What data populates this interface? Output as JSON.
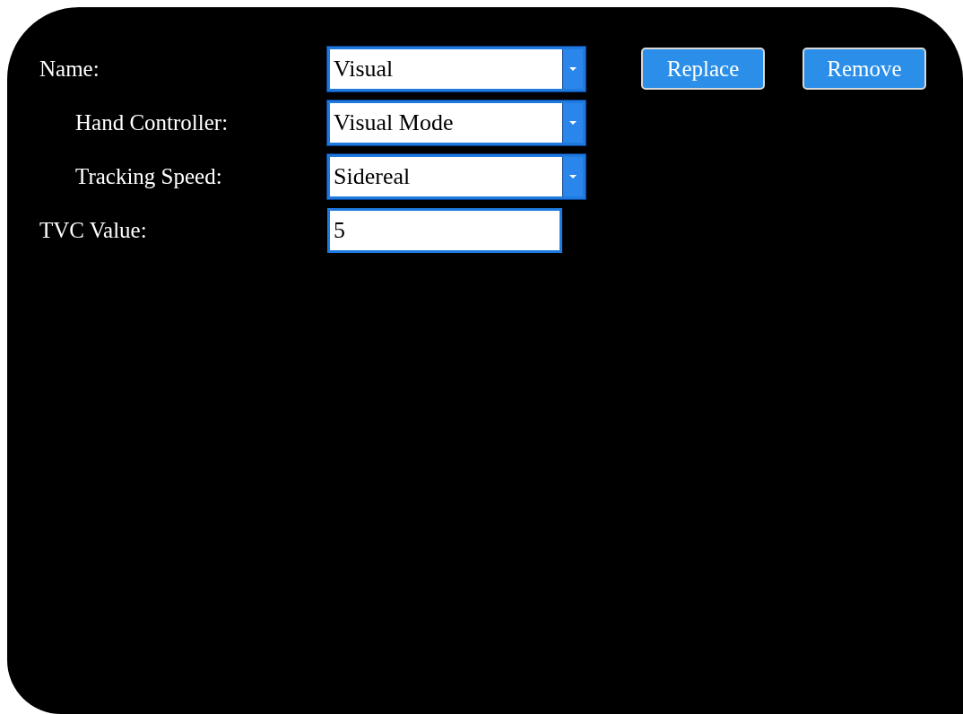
{
  "fields": [
    {
      "kind": "select",
      "label": "Name:",
      "value": "Visual",
      "children": [
        {
          "kind": "select",
          "label": "Hand Controller:",
          "value": "Visual Mode"
        },
        {
          "kind": "select",
          "label": "Tracking Speed:",
          "value": "Sidereal"
        }
      ]
    },
    {
      "kind": "text",
      "label": "TVC Value:",
      "value": "5"
    }
  ],
  "buttons": [
    "Replace",
    "Remove"
  ]
}
